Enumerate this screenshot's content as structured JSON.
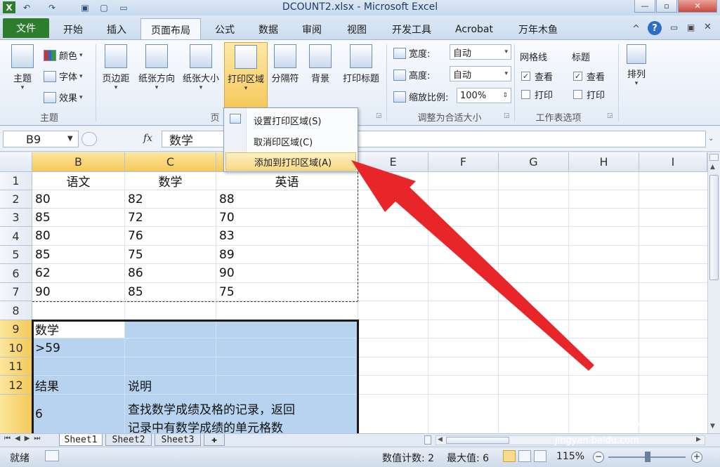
{
  "title_bar": {
    "title": "DCOUNT2.xlsx - Microsoft Excel"
  },
  "tabs": [
    "文件",
    "开始",
    "插入",
    "页面布局",
    "公式",
    "数据",
    "审阅",
    "视图",
    "开发工具",
    "Acrobat",
    "万年木鱼"
  ],
  "ribbon": {
    "theme": {
      "theme_label": "主题",
      "colors": "颜色",
      "fonts": "字体",
      "effects": "效果",
      "group_label": "主题"
    },
    "page_setup": {
      "margins": "页边距",
      "orientation": "纸张方向",
      "size": "纸张大小",
      "print_area": "打印区域",
      "breaks": "分隔符",
      "background": "背景",
      "print_titles": "打印标题",
      "group_label": "页"
    },
    "scale_to_fit": {
      "width_label": "宽度:",
      "width_value": "自动",
      "height_label": "高度:",
      "height_value": "自动",
      "scale_label": "缩放比例:",
      "scale_value": "100%",
      "group_label": "调整为合适大小"
    },
    "sheet_options": {
      "gridlines": "网格线",
      "headings": "标题",
      "view": "查看",
      "print": "打印",
      "group_label": "工作表选项"
    },
    "arrange": {
      "label": "排列"
    }
  },
  "print_area_menu": {
    "items": [
      "设置打印区域(S)",
      "取消印区域(C)",
      "添加到打印区域(A)"
    ],
    "hovered_index": 2
  },
  "formula_bar": {
    "name_box": "B9",
    "fx": "fx",
    "value": "数学"
  },
  "grid": {
    "columns": [
      "B",
      "C",
      "D",
      "E",
      "F",
      "G",
      "H",
      "I"
    ],
    "rows": [
      "1",
      "2",
      "3",
      "4",
      "5",
      "6",
      "7",
      "8",
      "9",
      "10",
      "11",
      "12",
      "13"
    ],
    "cells": {
      "r1": [
        "语文",
        "数学",
        "英语"
      ],
      "r2": [
        "80",
        "82",
        "88"
      ],
      "r3": [
        "85",
        "72",
        "70"
      ],
      "r4": [
        "80",
        "76",
        "83"
      ],
      "r5": [
        "85",
        "75",
        "89"
      ],
      "r6": [
        "62",
        "86",
        "90"
      ],
      "r7": [
        "90",
        "85",
        "75"
      ],
      "r9": "数学",
      "r10": ">59",
      "r12_b": "结果",
      "r12_c": "说明",
      "r13_b": "6",
      "r13_c_line1": "查找数学成绩及格的记录，返回",
      "r13_c_line2": "记录中有数学成绩的单元格数"
    }
  },
  "sheets": [
    "Sheet1",
    "Sheet2",
    "Sheet3"
  ],
  "status_bar": {
    "ready": "就绪",
    "count": "数值计数: 2",
    "max": "最大值: 6",
    "zoom": "115%"
  },
  "watermark": {
    "brand": "Bai",
    "brand2": "du",
    "brand3": "经验",
    "url": "jingyan.baidu.com"
  }
}
